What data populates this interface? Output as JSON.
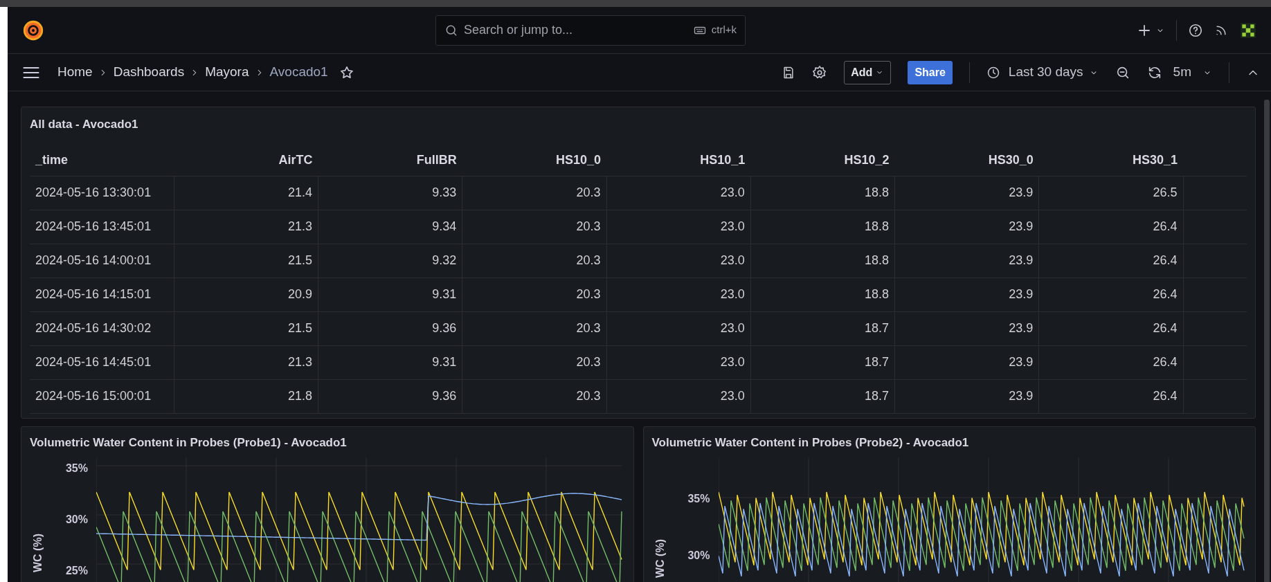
{
  "topbar": {
    "search_placeholder": "Search or jump to...",
    "shortcut": "ctrl+k"
  },
  "breadcrumbs": [
    {
      "label": "Home",
      "current": false
    },
    {
      "label": "Dashboards",
      "current": false
    },
    {
      "label": "Mayora",
      "current": false
    },
    {
      "label": "Avocado1",
      "current": true
    }
  ],
  "toolbar": {
    "add": "Add",
    "share": "Share",
    "time_range": "Last 30 days",
    "refresh": "5m"
  },
  "table_panel": {
    "title": "All data - Avocado1",
    "columns": [
      "_time",
      "AirTC",
      "FullBR",
      "HS10_0",
      "HS10_1",
      "HS10_2",
      "HS30_0",
      "HS30_1"
    ],
    "rows": [
      [
        "2024-05-16 13:30:01",
        "21.4",
        "9.33",
        "20.3",
        "23.0",
        "18.8",
        "23.9",
        "26.5"
      ],
      [
        "2024-05-16 13:45:01",
        "21.3",
        "9.34",
        "20.3",
        "23.0",
        "18.8",
        "23.9",
        "26.4"
      ],
      [
        "2024-05-16 14:00:01",
        "21.5",
        "9.32",
        "20.3",
        "23.0",
        "18.8",
        "23.9",
        "26.4"
      ],
      [
        "2024-05-16 14:15:01",
        "20.9",
        "9.31",
        "20.3",
        "23.0",
        "18.8",
        "23.9",
        "26.4"
      ],
      [
        "2024-05-16 14:30:02",
        "21.5",
        "9.36",
        "20.3",
        "23.0",
        "18.7",
        "23.9",
        "26.4"
      ],
      [
        "2024-05-16 14:45:01",
        "21.3",
        "9.31",
        "20.3",
        "23.0",
        "18.7",
        "23.9",
        "26.4"
      ],
      [
        "2024-05-16 15:00:01",
        "21.8",
        "9.36",
        "20.3",
        "23.0",
        "18.7",
        "23.9",
        "26.4"
      ]
    ]
  },
  "chart_panels": [
    {
      "title": "Volumetric Water Content in Probes (Probe1) - Avocado1",
      "y_axis_label": "WC (%)",
      "y_ticks": [
        "35%",
        "30%",
        "25%"
      ]
    },
    {
      "title": "Volumetric Water Content in Probes (Probe2) - Avocado1",
      "y_axis_label": "WC (%)",
      "y_ticks": [
        "35%",
        "30%"
      ]
    }
  ]
}
